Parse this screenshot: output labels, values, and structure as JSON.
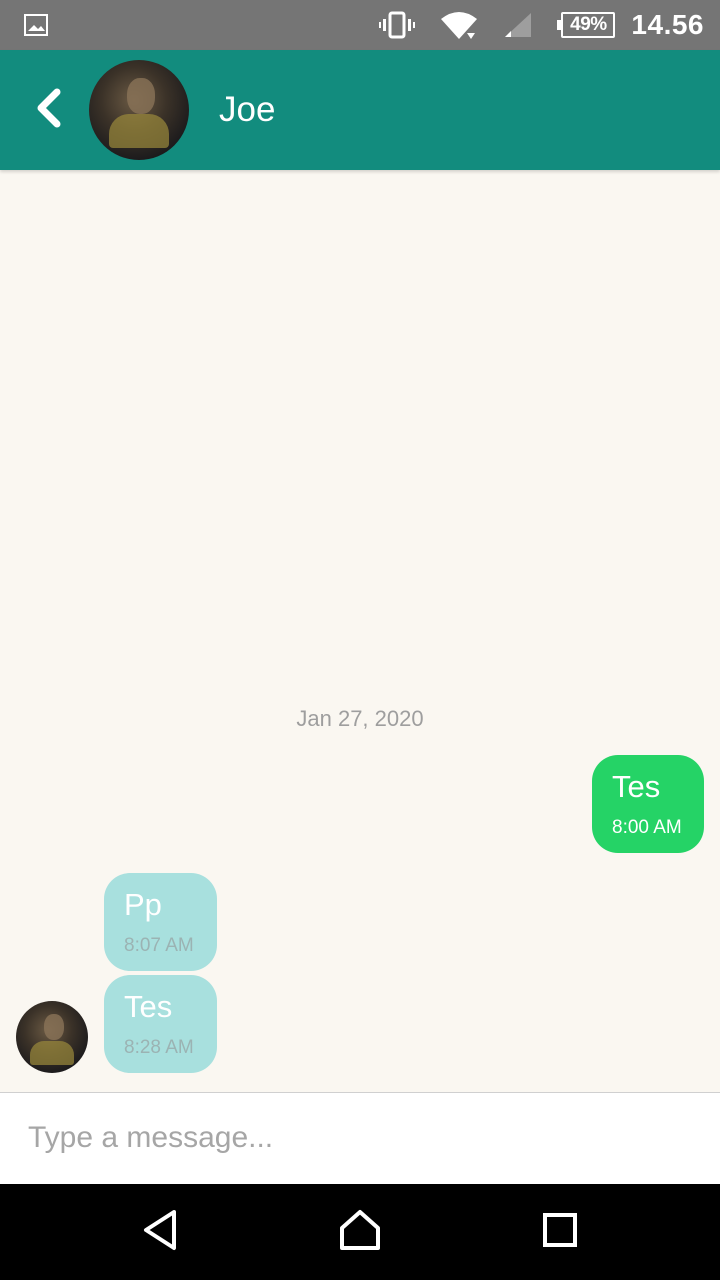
{
  "status_bar": {
    "left_icon": "image-notification-icon",
    "icons": [
      "vibrate-icon",
      "wifi-icon",
      "cell-signal-icon"
    ],
    "battery": "49%",
    "time": "14.56"
  },
  "header": {
    "contact_name": "Joe",
    "back_icon": "chevron-left-icon"
  },
  "chat": {
    "date_separator": "Jan 27, 2020",
    "messages": [
      {
        "direction": "outgoing",
        "text": "Tes",
        "time": "8:00 AM"
      },
      {
        "direction": "incoming",
        "text": "Pp",
        "time": "8:07 AM"
      },
      {
        "direction": "incoming",
        "text": "Tes",
        "time": "8:28 AM"
      }
    ]
  },
  "composer": {
    "placeholder": "Type a message...",
    "value": ""
  },
  "nav_bar": {
    "icons": [
      "nav-back-icon",
      "nav-home-icon",
      "nav-recents-icon"
    ]
  },
  "colors": {
    "toolbar": "#128c7e",
    "outgoing_bubble": "#25d366",
    "incoming_bubble": "#a8e0de",
    "chat_background": "#faf7f1"
  }
}
